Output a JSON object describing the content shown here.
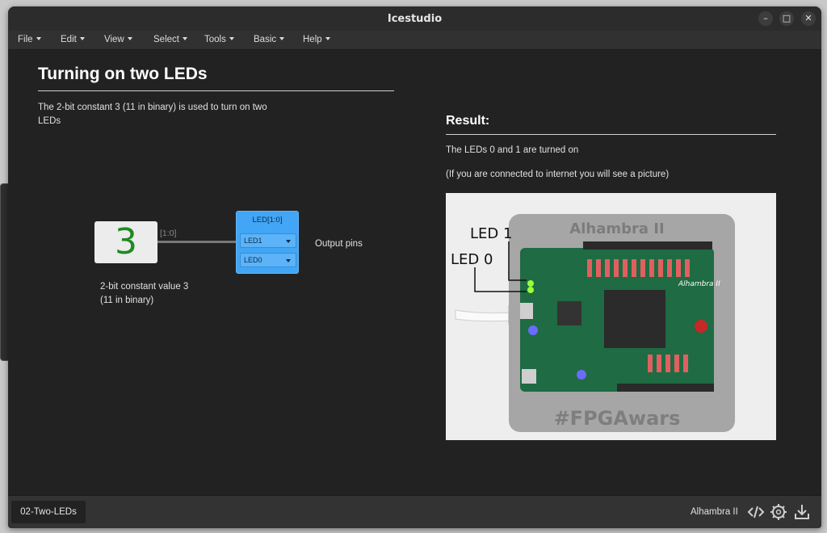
{
  "window": {
    "title": "Icestudio"
  },
  "menubar": [
    {
      "label": "File"
    },
    {
      "label": "Edit"
    },
    {
      "label": "View"
    },
    {
      "label": "Select"
    },
    {
      "label": "Tools"
    },
    {
      "label": "Basic"
    },
    {
      "label": "Help"
    }
  ],
  "left_panel": {
    "heading": "Turning on two LEDs",
    "description": "The 2-bit constant 3 (11 in binary) is used to turn on two LEDs",
    "constant_block": {
      "value": "3"
    },
    "wire_label": "[1:0]",
    "led_block": {
      "title": "LED[1:0]",
      "pins": [
        "LED1",
        "LED0"
      ]
    },
    "output_label": "Output pins",
    "constant_caption_line1": "2-bit constant value 3",
    "constant_caption_line2": "(11 in binary)"
  },
  "right_panel": {
    "heading": "Result:",
    "text1": "The LEDs 0 and 1 are turned on",
    "text2": "(If you are connected to internet you will see a picture)",
    "photo": {
      "label_led1": "LED 1",
      "label_led0": "LED 0",
      "board_text": "Alhambra II",
      "board_text_small": "Alhambra II",
      "hashtag": "#FPGAwars"
    }
  },
  "statusbar": {
    "tab": "02-Two-LEDs",
    "board": "Alhambra II"
  },
  "colors": {
    "accent": "#42a5f5",
    "constant_value": "#1f8a1f",
    "background": "#222222"
  }
}
